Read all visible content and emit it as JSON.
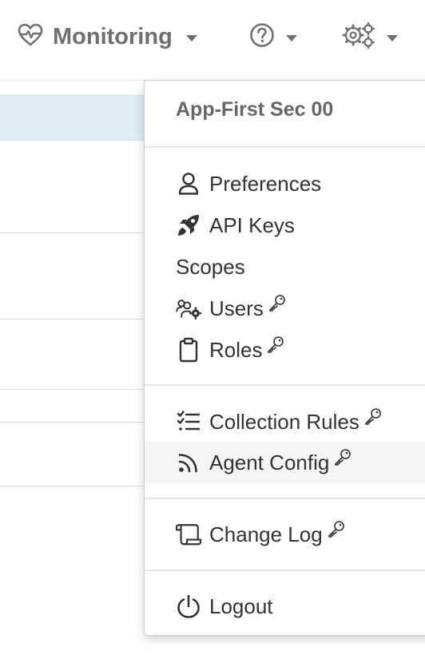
{
  "topnav": {
    "monitoring_label": "Monitoring",
    "monitoring_icon": "heart-pulse-icon",
    "help_icon": "question-circle-icon",
    "settings_icon": "gears-icon"
  },
  "menu": {
    "header": "App-First Sec 00",
    "items": [
      {
        "label": "Preferences",
        "icon": "user-icon",
        "restricted": false
      },
      {
        "label": "API Keys",
        "icon": "rocket-icon",
        "restricted": false
      },
      {
        "label": "Scopes",
        "icon": "",
        "restricted": false
      },
      {
        "label": "Users",
        "icon": "users-cog-icon",
        "restricted": true
      },
      {
        "label": "Roles",
        "icon": "clipboard-icon",
        "restricted": true
      },
      {
        "label": "Collection Rules",
        "icon": "tasks-icon",
        "restricted": true
      },
      {
        "label": "Agent Config",
        "icon": "rss-icon",
        "restricted": true,
        "hovered": true
      },
      {
        "label": "Change Log",
        "icon": "scroll-icon",
        "restricted": true
      },
      {
        "label": "Logout",
        "icon": "power-icon",
        "restricted": false
      }
    ]
  },
  "colors": {
    "nav_text": "#707070",
    "selected_row": "#dcedf5",
    "hover_item": "#f5f5f5",
    "menu_text": "#333333"
  }
}
